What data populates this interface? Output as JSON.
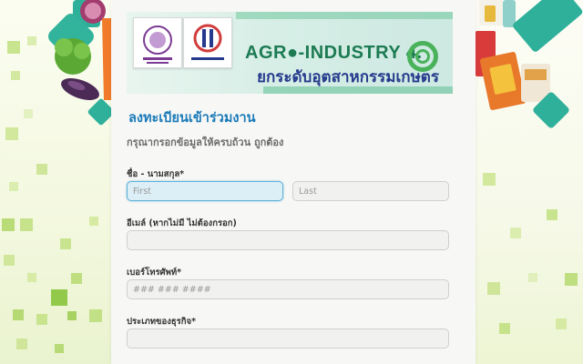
{
  "banner": {
    "title": "AGR●-INDUSTRY 4.",
    "subtitle": "ยกระดับอุตสาหกรรมเกษตร"
  },
  "form": {
    "title": "ลงทะเบียนเข้าร่วมงาน",
    "description": "กรุณากรอกข้อมูลให้ครบถ้วน ถูกต้อง",
    "fields": {
      "name": {
        "label": "ชื่อ - นามสกุล*",
        "first": {
          "value": "",
          "placeholder": "First"
        },
        "last": {
          "value": "",
          "placeholder": "Last"
        }
      },
      "email": {
        "label": "อีเมล์ (หากไม่มี ไม่ต้องกรอก)",
        "value": "",
        "placeholder": ""
      },
      "phone": {
        "label": "เบอร์โทรศัพท์*",
        "value": "",
        "placeholder": "### ### ####"
      },
      "business_type": {
        "label": "ประเภทของธุรกิจ*",
        "value": "",
        "placeholder": ""
      }
    }
  },
  "colors": {
    "accent": "#1b7bb8",
    "focus_border": "#5fb2d8",
    "card_bg": "#f7f7f5",
    "page_bg": "#f4f8e6",
    "banner_green": "#1c7b52",
    "banner_blue": "#253a8c"
  }
}
